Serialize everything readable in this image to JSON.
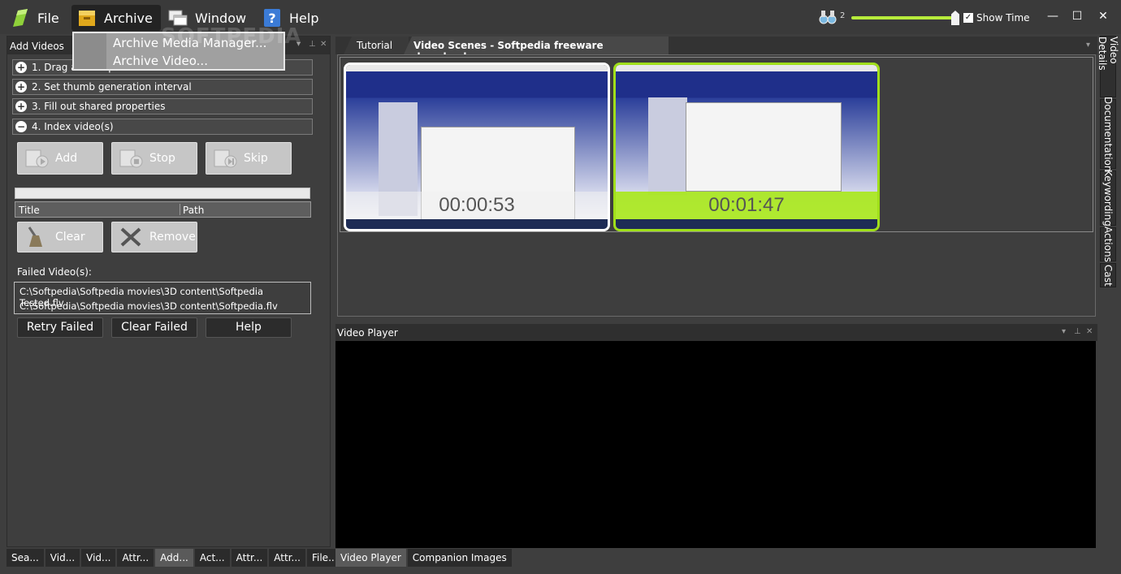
{
  "menubar": {
    "file_label": "File",
    "archive_label": "Archive",
    "window_label": "Window",
    "help_label": "Help"
  },
  "archive_menu": {
    "items": [
      "Archive Media Manager...",
      "Archive Video..."
    ]
  },
  "toolbar": {
    "zoom_value": "2",
    "zoom_level": 0.97,
    "show_time_label": "Show Time",
    "show_time_checked": true
  },
  "watermark": "SOFTPEDIA",
  "left_panel": {
    "title": "Add Videos",
    "steps": [
      "1. Drag and drop",
      "2. Set thumb generation interval",
      "3. Fill out shared properties",
      "4. Index video(s)"
    ],
    "add_label": "Add",
    "stop_label": "Stop",
    "skip_label": "Skip",
    "table": {
      "title_col": "Title",
      "path_col": "Path"
    },
    "clear_label": "Clear",
    "remove_label": "Remove",
    "failed_label": "Failed Video(s):",
    "failed_videos": [
      "C:\\Softpedia\\Softpedia movies\\3D content\\Softpedia Tested.flv",
      "C:\\Softpedia\\Softpedia movies\\3D content\\Softpedia.flv"
    ],
    "retry_label": "Retry Failed",
    "clear_failed_label": "Clear Failed",
    "help_label": "Help"
  },
  "bottom_left_tabs": [
    "Sea...",
    "Vid...",
    "Vid...",
    "Attr...",
    "Add...",
    "Act...",
    "Attr...",
    "Attr...",
    "File..."
  ],
  "scenes": {
    "tab_tutorial": "Tutorial",
    "tab_scenes": "Video Scenes - Softpedia freeware downloads.wmv",
    "thumbs": [
      {
        "time": "00:00:53"
      },
      {
        "time": "00:01:47"
      }
    ]
  },
  "right_vtabs": [
    "Video Details",
    "Documentation",
    "Keywording",
    "Actions",
    "Cast"
  ],
  "video_player": {
    "title": "Video Player",
    "tabs": [
      "Video Player",
      "Companion Images"
    ]
  },
  "colors": {
    "accent_green": "#a0df1a",
    "panel_bg": "#3e3e3e",
    "header_bg": "#2f2f2f"
  }
}
